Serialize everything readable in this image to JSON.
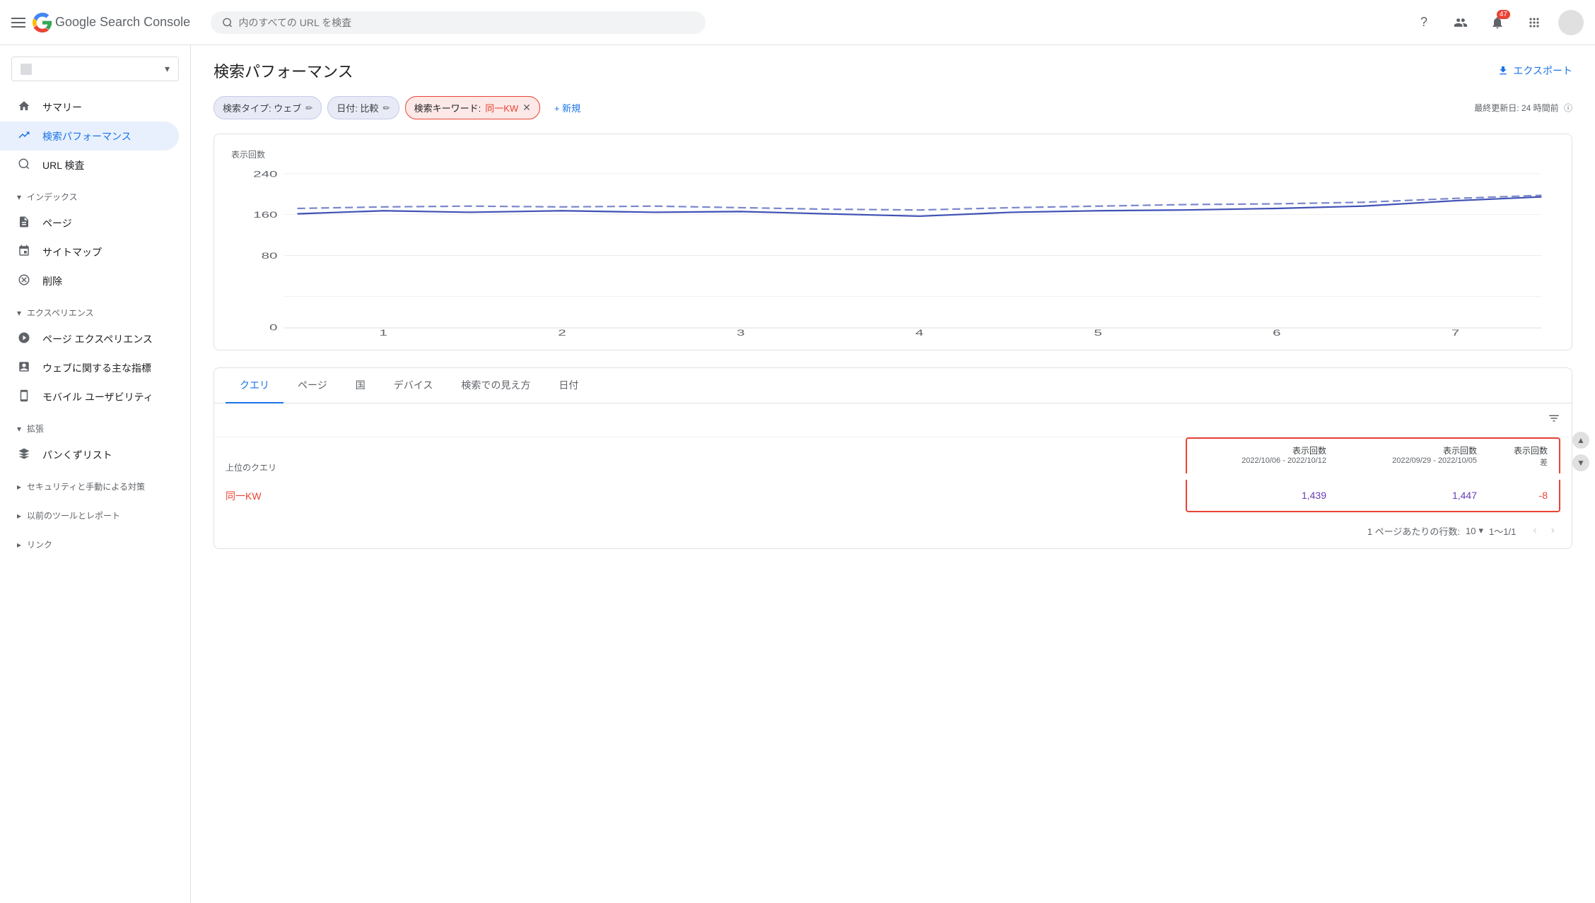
{
  "app": {
    "name": "Google Search Console"
  },
  "topbar": {
    "search_placeholder": "内のすべての URL を検査",
    "notification_count": "47",
    "icons": {
      "help": "?",
      "people": "👤",
      "grid": "⋮⋮⋮"
    }
  },
  "sidebar": {
    "property": {
      "name": ""
    },
    "nav_items": [
      {
        "id": "summary",
        "label": "サマリー",
        "icon": "🏠",
        "active": false
      },
      {
        "id": "search-performance",
        "label": "検索パフォーマンス",
        "icon": "📈",
        "active": true
      },
      {
        "id": "url-inspection",
        "label": "URL 検査",
        "icon": "🔍",
        "active": false
      }
    ],
    "sections": [
      {
        "id": "index",
        "label": "インデックス",
        "items": [
          {
            "id": "pages",
            "label": "ページ",
            "icon": "📄"
          },
          {
            "id": "sitemap",
            "label": "サイトマップ",
            "icon": "🗂"
          },
          {
            "id": "removal",
            "label": "削除",
            "icon": "🚫"
          }
        ]
      },
      {
        "id": "experience",
        "label": "エクスペリエンス",
        "items": [
          {
            "id": "page-experience",
            "label": "ページ エクスペリエンス",
            "icon": "⭐"
          },
          {
            "id": "web-vitals",
            "label": "ウェブに関する主な指標",
            "icon": "📊"
          },
          {
            "id": "mobile-usability",
            "label": "モバイル ユーザビリティ",
            "icon": "📱"
          }
        ]
      },
      {
        "id": "extensions",
        "label": "拡張",
        "items": [
          {
            "id": "breadcrumbs",
            "label": "パンくずリスト",
            "icon": "🔷"
          }
        ]
      },
      {
        "id": "security",
        "label": "セキュリティと手動による対策",
        "items": []
      },
      {
        "id": "legacy",
        "label": "以前のツールとレポート",
        "items": []
      },
      {
        "id": "links",
        "label": "リンク",
        "items": []
      }
    ]
  },
  "page": {
    "title": "検索パフォーマンス",
    "export_label": "エクスポート",
    "last_updated": "最終更新日: 24 時間前"
  },
  "filters": {
    "chips": [
      {
        "id": "search-type",
        "label": "検索タイプ: ウェブ",
        "editable": true,
        "removable": false
      },
      {
        "id": "date",
        "label": "日付: 比較",
        "editable": true,
        "removable": false
      },
      {
        "id": "keyword",
        "label": "検索キーワード: 同一KW",
        "editable": false,
        "removable": true,
        "highlight": true
      }
    ],
    "new_label": "+ 新規"
  },
  "chart": {
    "y_label": "表示回数",
    "y_max": 240,
    "y_ticks": [
      240,
      160,
      80,
      0
    ],
    "x_ticks": [
      1,
      2,
      3,
      4,
      5,
      6,
      7
    ],
    "line1_color": "#3f51b5",
    "line2_color": "#9c27b0"
  },
  "tabs": [
    {
      "id": "query",
      "label": "クエリ",
      "active": true
    },
    {
      "id": "page",
      "label": "ページ",
      "active": false
    },
    {
      "id": "country",
      "label": "国",
      "active": false
    },
    {
      "id": "device",
      "label": "デバイス",
      "active": false
    },
    {
      "id": "search-appearance",
      "label": "検索での見え方",
      "active": false
    },
    {
      "id": "date",
      "label": "日付",
      "active": false
    }
  ],
  "table": {
    "top_queries_label": "上位のクエリ",
    "columns": [
      {
        "id": "impressions1",
        "label": "表示回数",
        "date_range": "2022/10/06 - 2022/10/12"
      },
      {
        "id": "impressions2",
        "label": "表示回数",
        "date_range": "2022/09/29 - 2022/10/05"
      },
      {
        "id": "diff",
        "label": "表示回数",
        "sublabel": "差"
      }
    ],
    "rows": [
      {
        "query": "同一KW",
        "impressions1": "1,439",
        "impressions2": "1,447",
        "diff": "-8",
        "highlighted": true
      }
    ],
    "pagination": {
      "rows_per_page_label": "1 ページあたりの行数:",
      "rows_per_page": "10",
      "page_range": "1〜1/1"
    }
  }
}
